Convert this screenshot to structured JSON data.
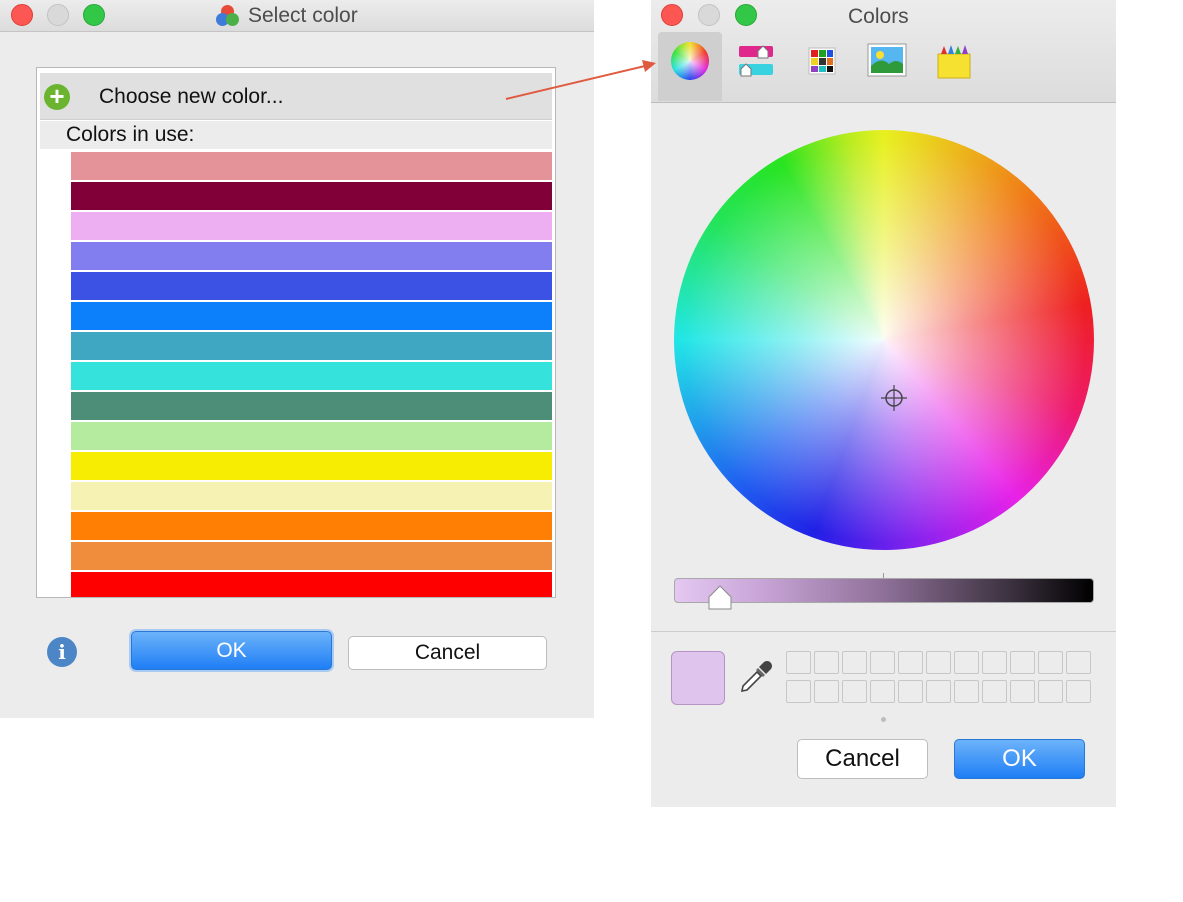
{
  "select_window": {
    "title": "Select color",
    "choose_new_label": "Choose new color...",
    "colors_in_use_label": "Colors in use:",
    "swatches": [
      "#e49399",
      "#810038",
      "#edaff2",
      "#837ef0",
      "#3b52e4",
      "#0c80fb",
      "#40a7c3",
      "#36e2dc",
      "#4d8e78",
      "#b5eb9f",
      "#f7ed02",
      "#f5f2b3",
      "#ff7f05",
      "#ef8d3c",
      "#ff0000"
    ],
    "ok_label": "OK",
    "cancel_label": "Cancel"
  },
  "colors_window": {
    "title": "Colors",
    "tabs": [
      "color-wheel",
      "color-sliders",
      "color-palettes",
      "image-palettes",
      "pencils"
    ],
    "active_tab": "color-wheel",
    "current_color": "#dfc4ee",
    "brightness": 0.11,
    "wells_count": 22,
    "cancel_label": "Cancel",
    "ok_label": "OK"
  }
}
